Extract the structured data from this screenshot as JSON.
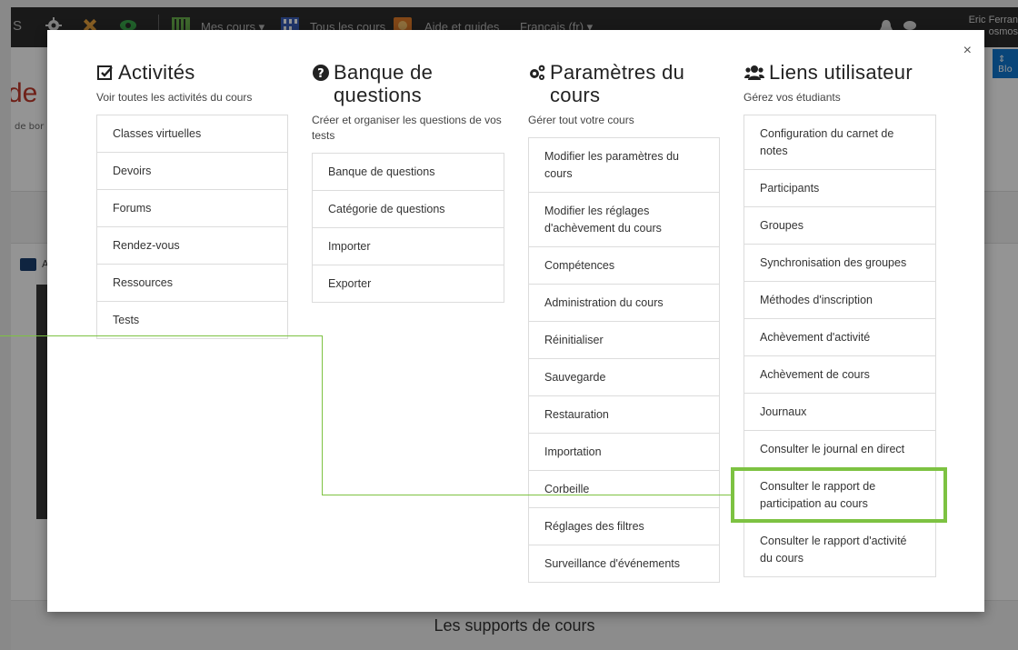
{
  "navbar": {
    "brand_fragment": "S",
    "my_courses": "Mes cours",
    "all_courses": "Tous les cours",
    "help": "Aide et guides",
    "language": "Français (fr)",
    "user_name": "Eric Ferran",
    "user_role_fragment": "osmos"
  },
  "background": {
    "title_fragment": "de U",
    "subtitle_fragment": "de bor",
    "chat_fragment": "A",
    "right_button_fragment": "Blo",
    "bottom_label": "Les supports de cours"
  },
  "modal": {
    "close": "×",
    "columns": [
      {
        "title": "Activités",
        "icon": "check-square-icon",
        "desc": "Voir toutes les activités du cours",
        "items": [
          "Classes virtuelles",
          "Devoirs",
          "Forums",
          "Rendez-vous",
          "Ressources",
          "Tests"
        ]
      },
      {
        "title": "Banque de questions",
        "icon": "question-circle-icon",
        "desc": "Créer et organiser les questions de vos tests",
        "items": [
          "Banque de questions",
          "Catégorie de questions",
          "Importer",
          "Exporter"
        ]
      },
      {
        "title": "Paramètres du cours",
        "icon": "cogs-icon",
        "desc": "Gérer tout votre cours",
        "items": [
          "Modifier les paramètres du cours",
          "Modifier les réglages d'achèvement du cours",
          "Compétences",
          "Administration du cours",
          "Réinitialiser",
          "Sauvegarde",
          "Restauration",
          "Importation",
          "Corbeille",
          "Réglages des filtres",
          "Surveillance d'événements"
        ]
      },
      {
        "title": "Liens utilisateur",
        "icon": "users-icon",
        "desc": "Gérez vos étudiants",
        "items": [
          "Configuration du carnet de notes",
          "Participants",
          "Groupes",
          "Synchronisation des groupes",
          "Méthodes d'inscription",
          "Achèvement d'activité",
          "Achèvement de cours",
          "Journaux",
          "Consulter le journal en direct",
          "Consulter le rapport de participation au cours",
          "Consulter le rapport d'activité du cours"
        ]
      }
    ]
  },
  "colors": {
    "navbar_bg": "#2c2c2c",
    "highlight": "#7dc242",
    "accent_blue": "#1177d1"
  }
}
